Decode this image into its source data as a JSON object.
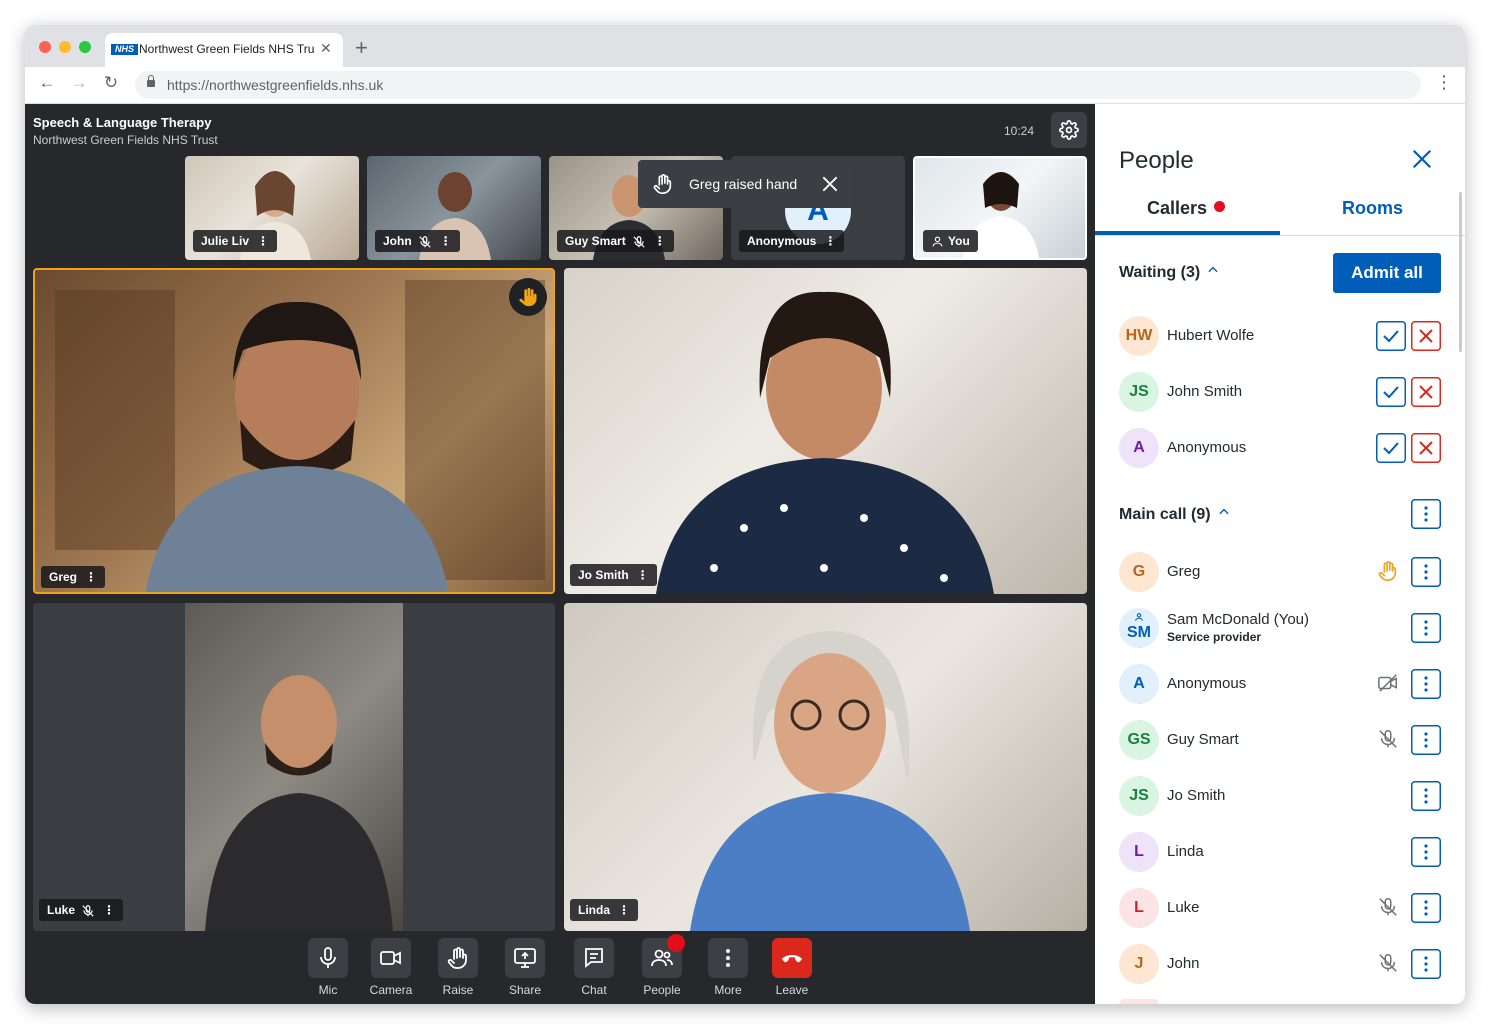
{
  "browser": {
    "tab_title": "Northwest Green Fields NHS Trust",
    "tab_logo": "NHS",
    "url": "https://northwestgreenfields.nhs.uk"
  },
  "meeting": {
    "title": "Speech & Language Therapy",
    "subtitle": "Northwest Green Fields NHS Trust",
    "time": "10:24"
  },
  "thumbnails": [
    {
      "name": "Julie Liv",
      "muted": false
    },
    {
      "name": "John",
      "muted": true
    },
    {
      "name": "Guy Smart",
      "muted": true
    },
    {
      "name": "Anonymous",
      "initial": "A",
      "muted": false
    },
    {
      "name": "You",
      "is_self": true
    }
  ],
  "toast": {
    "text": "Greg raised hand"
  },
  "tiles": [
    {
      "name": "Greg",
      "hand_raised": true,
      "highlight_color": "#f0a319"
    },
    {
      "name": "Jo Smith"
    },
    {
      "name": "Luke",
      "muted": true
    },
    {
      "name": "Linda"
    }
  ],
  "controls": [
    {
      "label": "Mic",
      "icon": "mic-icon"
    },
    {
      "label": "Camera",
      "icon": "camera-icon"
    },
    {
      "label": "Raise",
      "icon": "hand-icon"
    },
    {
      "label": "Share",
      "icon": "share-screen-icon"
    },
    {
      "label": "Chat",
      "icon": "chat-icon"
    },
    {
      "label": "People",
      "icon": "people-icon",
      "notification": true
    },
    {
      "label": "More",
      "icon": "more-vertical-icon"
    },
    {
      "label": "Leave",
      "icon": "hang-up-icon",
      "color": "#da291c"
    }
  ],
  "people_panel": {
    "title": "People",
    "tabs": [
      "Callers",
      "Rooms"
    ],
    "active_tab": "Callers",
    "accent": "#005eb8",
    "waiting": {
      "heading": "Waiting (3)",
      "admit_label": "Admit all",
      "people": [
        {
          "initials": "HW",
          "name": "Hubert Wolfe",
          "bg": "#fde7d2",
          "fg": "#b5651d"
        },
        {
          "initials": "JS",
          "name": "John Smith",
          "bg": "#d9f5e1",
          "fg": "#1a7f3b"
        },
        {
          "initials": "A",
          "name": "Anonymous",
          "bg": "#efe3f9",
          "fg": "#6b1fa8"
        }
      ]
    },
    "main_call": {
      "heading": "Main call (9)",
      "people": [
        {
          "initials": "G",
          "name": "Greg",
          "bg": "#fde7d2",
          "fg": "#b5651d",
          "status": "hand-raised-icon"
        },
        {
          "initials": "SM",
          "name": "Sam McDonald (You)",
          "role": "Service provider",
          "bg": "#e1f0fb",
          "fg": "#005eb8"
        },
        {
          "initials": "A",
          "name": "Anonymous",
          "bg": "#e1f0fb",
          "fg": "#005eb8",
          "status": "camera-off-icon"
        },
        {
          "initials": "GS",
          "name": "Guy Smart",
          "bg": "#d9f5e1",
          "fg": "#1a7f3b",
          "status": "mic-off-icon"
        },
        {
          "initials": "JS",
          "name": "Jo Smith",
          "bg": "#d9f5e1",
          "fg": "#1a7f3b"
        },
        {
          "initials": "L",
          "name": "Linda",
          "bg": "#efe3f9",
          "fg": "#6b1fa8"
        },
        {
          "initials": "L",
          "name": "Luke",
          "bg": "#fde4e4",
          "fg": "#c0272d",
          "status": "mic-off-icon"
        },
        {
          "initials": "J",
          "name": "John",
          "bg": "#fde7d2",
          "fg": "#b5651d",
          "status": "mic-off-icon"
        }
      ]
    }
  }
}
